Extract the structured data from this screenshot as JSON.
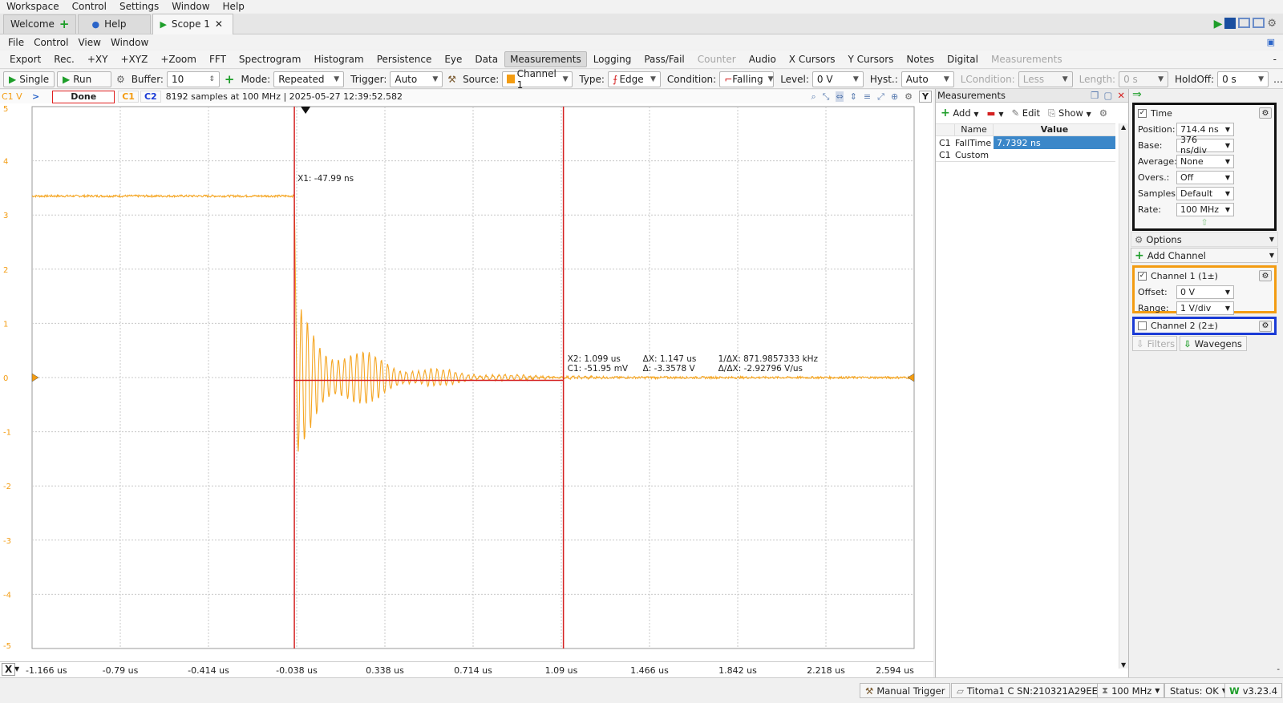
{
  "menu": [
    "Workspace",
    "Control",
    "Settings",
    "Window",
    "Help"
  ],
  "tabs": [
    {
      "label": "Welcome",
      "icon": "plus-icon"
    },
    {
      "label": "Help",
      "icon": "help-icon"
    },
    {
      "label": "Scope 1",
      "icon": "play-icon",
      "close": "✕"
    }
  ],
  "submenu": [
    "File",
    "Control",
    "View",
    "Window"
  ],
  "toolbar": [
    "Export",
    "Rec.",
    "+XY",
    "+XYZ",
    "+Zoom",
    "FFT",
    "Spectrogram",
    "Histogram",
    "Persistence",
    "Eye",
    "Data",
    "Measurements",
    "Logging",
    "Pass/Fail",
    "Counter",
    "Audio",
    "X Cursors",
    "Y Cursors",
    "Notes",
    "Digital",
    "Measurements"
  ],
  "acq": {
    "single": "Single",
    "run": "Run",
    "buffer_label": "Buffer:",
    "buffer": "10",
    "mode_label": "Mode:",
    "mode": "Repeated",
    "trigger_label": "Trigger:",
    "trigger": "Auto",
    "source_label": "Source:",
    "source": "Channel 1",
    "type_label": "Type:",
    "type": "Edge",
    "condition_label": "Condition:",
    "condition": "Falling",
    "level_label": "Level:",
    "level": "0 V",
    "hyst_label": "Hyst.:",
    "hyst": "Auto",
    "lcond_label": "LCondition:",
    "lcond": "Less",
    "length_label": "Length:",
    "length": "0 s",
    "holdoff_label": "HoldOff:",
    "holdoff": "0 s"
  },
  "plot_status": {
    "axis_unit": "C1 V",
    "state": "Done",
    "c1": "C1",
    "c2": "C2",
    "info": "8192 samples at 100 MHz  | 2025-05-27 12:39:52.582",
    "y_label": "Y",
    "corner": "X"
  },
  "chart_data": {
    "type": "line",
    "yticks": [
      "5",
      "4",
      "3",
      "2",
      "1",
      "0",
      "-1",
      "-2",
      "-3",
      "-4",
      "-5"
    ],
    "xticks": [
      "-1.166 us",
      "-0.79 us",
      "-0.414 us",
      "-0.038 us",
      "0.338 us",
      "0.714 us",
      "1.09 us",
      "1.466 us",
      "1.842 us",
      "2.218 us",
      "2.594 us"
    ],
    "xlim_us": [
      -1.166,
      2.594
    ],
    "ylim": [
      -5,
      5
    ],
    "high_level_v": 3.35,
    "fall_time_us": -0.048,
    "ringing_peak_v": 1.4,
    "series_color": "#f5a623",
    "cursors": {
      "x1": "X1: -47.99 ns",
      "x2": "X2: 1.099 us",
      "c1": "C1: -51.95 mV",
      "dx": "ΔX: 1.147 us",
      "dy": "Δ: -3.3578 V",
      "inv_dx": "1/ΔX: 871.9857333 kHz",
      "dy_dx": "Δ/ΔX: -2.92796 V/us",
      "x1_us": -0.048,
      "x2_us": 1.099,
      "y2_v": -0.052,
      "color": "#d42020"
    }
  },
  "measurements": {
    "title": "Measurements",
    "add": "Add",
    "edit": "Edit",
    "show": "Show",
    "headers": [
      "Name",
      "Value"
    ],
    "rows": [
      {
        "ch": "C1",
        "name": "FallTime",
        "value": "7.7392 ns"
      },
      {
        "ch": "C1",
        "name": "Custom",
        "value": ""
      }
    ]
  },
  "time": {
    "title": "Time",
    "fields": [
      {
        "label": "Position:",
        "value": "714.4 ns"
      },
      {
        "label": "Base:",
        "value": "376 ns/div"
      },
      {
        "label": "Average:",
        "value": "None"
      },
      {
        "label": "Overs.:",
        "value": "Off"
      },
      {
        "label": "Samples:",
        "value": "Default"
      },
      {
        "label": "Rate:",
        "value": "100 MHz"
      }
    ]
  },
  "side": {
    "options": "Options",
    "add_channel": "Add Channel",
    "ch1": "Channel 1 (1±)",
    "offset_label": "Offset:",
    "offset": "0 V",
    "range_label": "Range:",
    "range": "1 V/div",
    "ch2": "Channel 2 (2±)",
    "filters": "Filters",
    "wavegens": "Wavegens"
  },
  "status": {
    "manual_trigger": "Manual Trigger",
    "device": "Titoma1 C SN:210321A29EE8",
    "rate": "100 MHz",
    "state": "Status: OK",
    "version": "v3.23.4"
  },
  "colors": {
    "ch1": "#f39c12",
    "ch2": "#1a3bd6",
    "time_box": "#111111",
    "cursor": "#d42020"
  }
}
